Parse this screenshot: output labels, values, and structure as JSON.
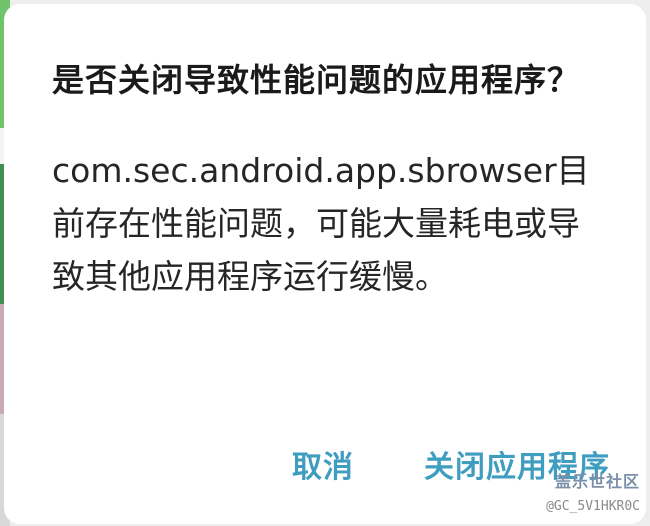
{
  "dialog": {
    "title": "是否关闭导致性能问题的应用程序？",
    "message": "com.sec.android.app.sbrowser目前存在性能问题，可能大量耗电或导致其他应用程序运行缓慢。",
    "buttons": {
      "cancel_label": "取消",
      "close_app_label": "关闭应用程序"
    }
  },
  "watermark": {
    "logo_text": "盖乐世社区",
    "user_tag": "@GC_5V1HKR0C"
  },
  "colors": {
    "accent": "#3f9dbf",
    "dialog_background": "#ffffff",
    "text_primary": "#1a1a1a"
  }
}
